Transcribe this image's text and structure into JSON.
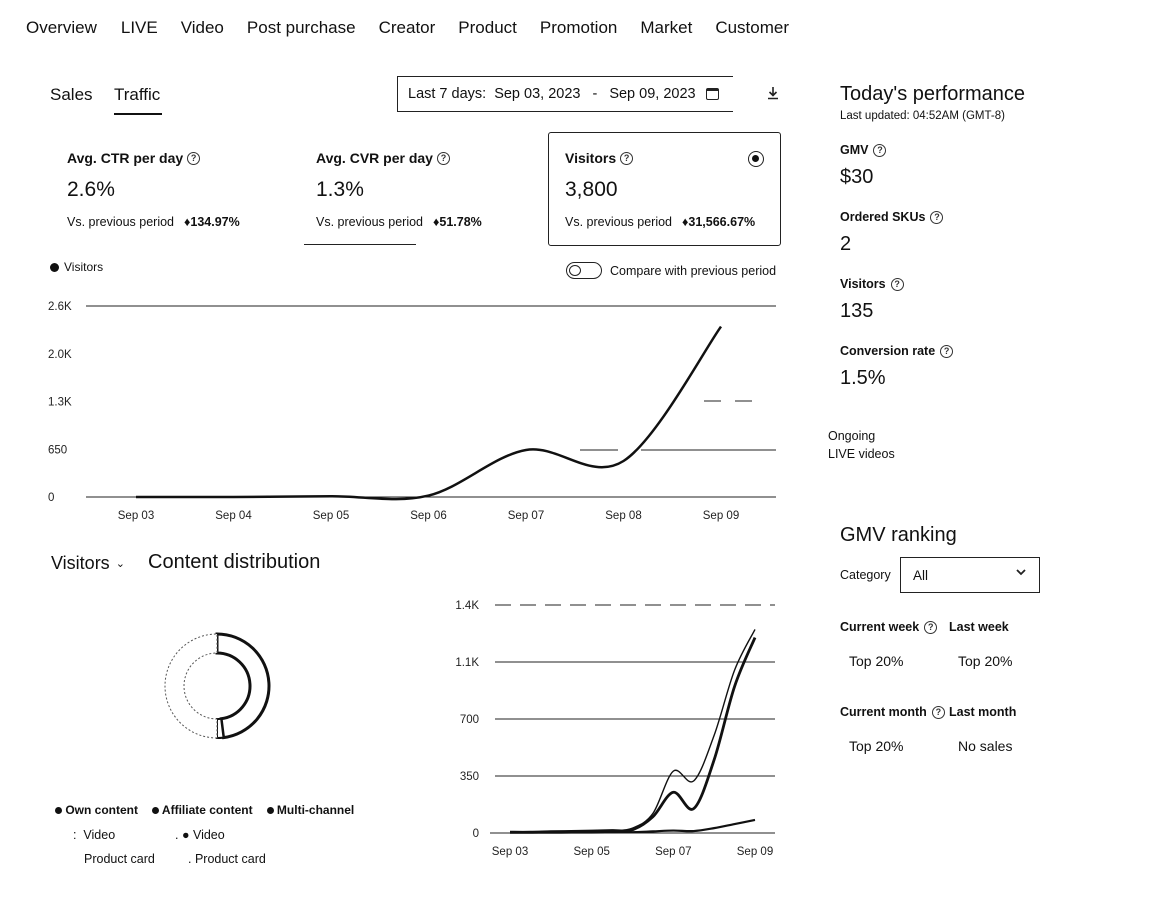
{
  "nav": {
    "items": [
      "Overview",
      "LIVE",
      "Video",
      "Post purchase",
      "Creator",
      "Product",
      "Promotion",
      "Market",
      "Customer"
    ]
  },
  "tabs": {
    "sales": "Sales",
    "traffic": "Traffic"
  },
  "date_range": {
    "preset": "Last 7 days:",
    "start": "Sep 03, 2023",
    "separator": "-",
    "end": "Sep 09, 2023"
  },
  "metrics": [
    {
      "title": "Avg. CTR per day",
      "value": "2.6%",
      "compare_label": "Vs. previous period",
      "delta": "134.97%"
    },
    {
      "title": "Avg. CVR per day",
      "value": "1.3%",
      "compare_label": "Vs. previous period",
      "delta": "51.78%"
    },
    {
      "title": "Visitors",
      "value": "3,800",
      "compare_label": "Vs. previous period",
      "delta": "31,566.67%"
    }
  ],
  "main_chart_legend": "Visitors",
  "compare_toggle_label": "Compare with previous period",
  "chart_data": [
    {
      "type": "line",
      "series": [
        {
          "name": "Visitors",
          "values": [
            0,
            0,
            10,
            20,
            640,
            490,
            2320
          ]
        }
      ],
      "categories": [
        "Sep 03",
        "Sep 04",
        "Sep 05",
        "Sep 06",
        "Sep 07",
        "Sep 08",
        "Sep 09"
      ],
      "y_ticks": [
        "0",
        "650",
        "1.3K",
        "2.0K",
        "2.6K"
      ],
      "ylim": [
        0,
        2600
      ]
    },
    {
      "type": "line",
      "categories": [
        "Sep 03",
        "Sep 05",
        "Sep 07",
        "Sep 09"
      ],
      "x": [
        3,
        3.5,
        4,
        4.5,
        5,
        5.5,
        6,
        6.5,
        7,
        7.5,
        8,
        8.5,
        9
      ],
      "series": [
        {
          "values": [
            5,
            5,
            8,
            10,
            12,
            15,
            30,
            120,
            380,
            320,
            600,
            1000,
            1250
          ]
        },
        {
          "values": [
            5,
            5,
            8,
            10,
            12,
            15,
            20,
            100,
            250,
            150,
            450,
            900,
            1200
          ]
        },
        {
          "values": [
            2,
            2,
            2,
            3,
            3,
            4,
            5,
            10,
            15,
            12,
            30,
            55,
            80
          ]
        }
      ],
      "y_ticks": [
        "0",
        "350",
        "700",
        "1.1K",
        "1.4K"
      ],
      "ylim": [
        0,
        1400
      ]
    }
  ],
  "content_section": {
    "metric_select": "Visitors",
    "title": "Content distribution",
    "donut": [
      {
        "name": "Own content",
        "share": 0.48
      },
      {
        "name": "Affiliate content",
        "share": 0.02
      },
      {
        "name": "Multi-channel",
        "share": 0.5
      }
    ],
    "legend": {
      "own": "Own content",
      "affiliate": "Affiliate content",
      "multi": "Multi-channel",
      "own_video": "Video",
      "own_product": "Product card",
      "aff_video": "Video",
      "aff_product": "Product card"
    }
  },
  "today": {
    "title": "Today's performance",
    "updated": "Last updated: 04:52AM (GMT-8)",
    "gmv_label": "GMV",
    "gmv_value": "$30",
    "skus_label": "Ordered SKUs",
    "skus_value": "2",
    "visitors_label": "Visitors",
    "visitors_value": "135",
    "conv_label": "Conversion rate",
    "conv_value": "1.5%",
    "ongoing_line1": "Ongoing",
    "ongoing_line2": "LIVE videos"
  },
  "ranking": {
    "title": "GMV ranking",
    "category_label": "Category",
    "category_value": "All",
    "current_week_label": "Current week",
    "last_week_label": "Last week",
    "current_week_value": "Top 20%",
    "last_week_value": "Top 20%",
    "current_month_label": "Current month",
    "last_month_label": "Last month",
    "current_month_value": "Top 20%",
    "last_month_value": "No sales"
  }
}
